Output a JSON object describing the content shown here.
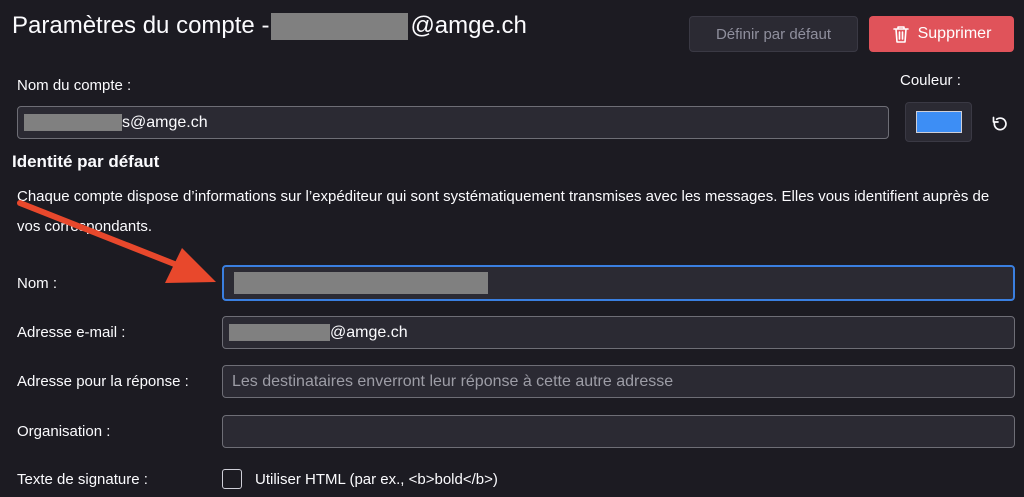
{
  "header": {
    "title_prefix": "Paramètres du compte - ",
    "title_suffix": "@amge.ch",
    "set_default_label": "Définir par défaut",
    "delete_label": "Supprimer"
  },
  "account": {
    "name_label": "Nom du compte :",
    "name_value_suffix": "s@amge.ch",
    "color_label": "Couleur :",
    "color_value": "#3d8ef5"
  },
  "identity": {
    "section_title": "Identité par défaut",
    "description": "Chaque compte dispose d’informations sur l’expéditeur qui sont systématiquement transmises avec les messages. Elles vous identifient auprès de vos correspondants.",
    "name_label": "Nom :",
    "email_label": "Adresse e-mail :",
    "email_value_suffix": "@amge.ch",
    "reply_label": "Adresse pour la réponse :",
    "reply_placeholder": "Les destinataires enverront leur réponse à cette autre adresse",
    "org_label": "Organisation :",
    "signature_label": "Texte de signature :",
    "use_html_label": "Utiliser HTML (par ex., <b>bold</b>)"
  },
  "colors": {
    "background": "#1c1b22",
    "delete_button": "#e0535a",
    "focus_border": "#3a7fe0",
    "annotation_arrow": "#e8482c"
  }
}
